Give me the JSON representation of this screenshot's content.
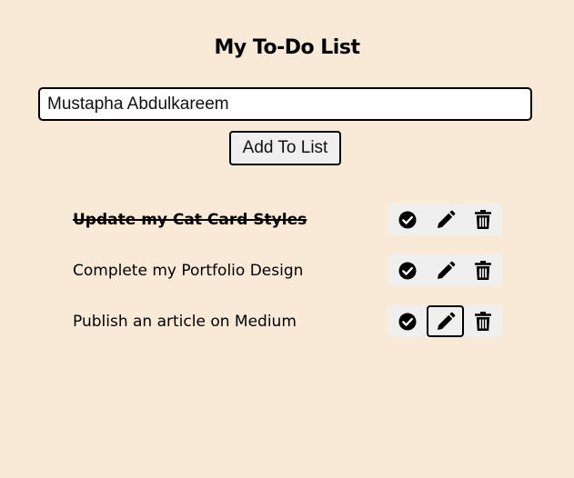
{
  "app": {
    "title": "My To-Do List"
  },
  "form": {
    "input_value": "Mustapha Abdulkareem",
    "add_label": "Add To List"
  },
  "todos": [
    {
      "text": "Update my Cat Card Styles",
      "completed": true
    },
    {
      "text": "Complete my Portfolio Design",
      "completed": false
    },
    {
      "text": "Publish an article on Medium",
      "completed": false
    }
  ],
  "icons": {
    "complete": "check-circle-icon",
    "edit": "pencil-icon",
    "delete": "trash-icon"
  },
  "colors": {
    "background": "#f9e9d7",
    "action_bar": "#efefef"
  }
}
